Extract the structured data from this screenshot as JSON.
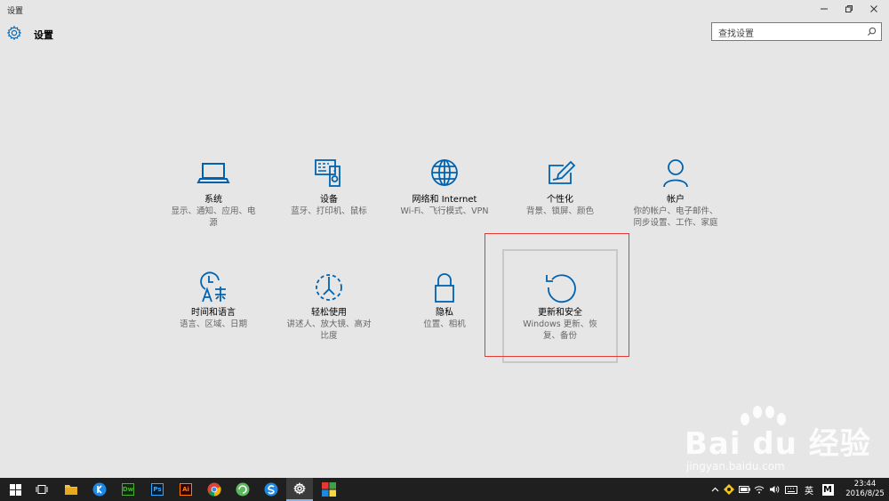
{
  "window": {
    "title": "设置"
  },
  "header": {
    "title": "设置",
    "search_placeholder": "查找设置"
  },
  "tiles": [
    {
      "name": "系统",
      "desc": "显示、通知、应用、电源",
      "icon": "laptop-icon"
    },
    {
      "name": "设备",
      "desc": "蓝牙、打印机、鼠标",
      "icon": "devices-icon"
    },
    {
      "name": "网络和 Internet",
      "desc": "Wi-Fi、飞行模式、VPN",
      "icon": "globe-icon"
    },
    {
      "name": "个性化",
      "desc": "背景、锁屏、颜色",
      "icon": "personalization-icon"
    },
    {
      "name": "帐户",
      "desc": "你的帐户、电子邮件、同步设置、工作、家庭",
      "icon": "person-icon"
    },
    {
      "name": "时间和语言",
      "desc": "语言、区域、日期",
      "icon": "time-language-icon"
    },
    {
      "name": "轻松使用",
      "desc": "讲述人、放大镜、高对比度",
      "icon": "ease-of-access-icon"
    },
    {
      "name": "隐私",
      "desc": "位置、相机",
      "icon": "lock-icon"
    },
    {
      "name": "更新和安全",
      "desc": "Windows 更新、恢复、备份",
      "icon": "update-icon"
    }
  ],
  "watermark": {
    "brand": "Bai du 经验",
    "url": "jingyan.baidu.com"
  },
  "taskbar": {
    "apps": [
      {
        "name": "Dw",
        "color": "#4caf2d"
      },
      {
        "name": "Ps",
        "color": "#31a8ff"
      },
      {
        "name": "Ai",
        "color": "#ff7c00"
      }
    ],
    "lang": "英",
    "ime": "M",
    "time": "23:44",
    "date": "2016/8/25"
  },
  "colors": {
    "accent": "#0063b1",
    "background": "#e6e6e6",
    "taskbar": "#1f1f1f",
    "highlight": "#e53935"
  }
}
